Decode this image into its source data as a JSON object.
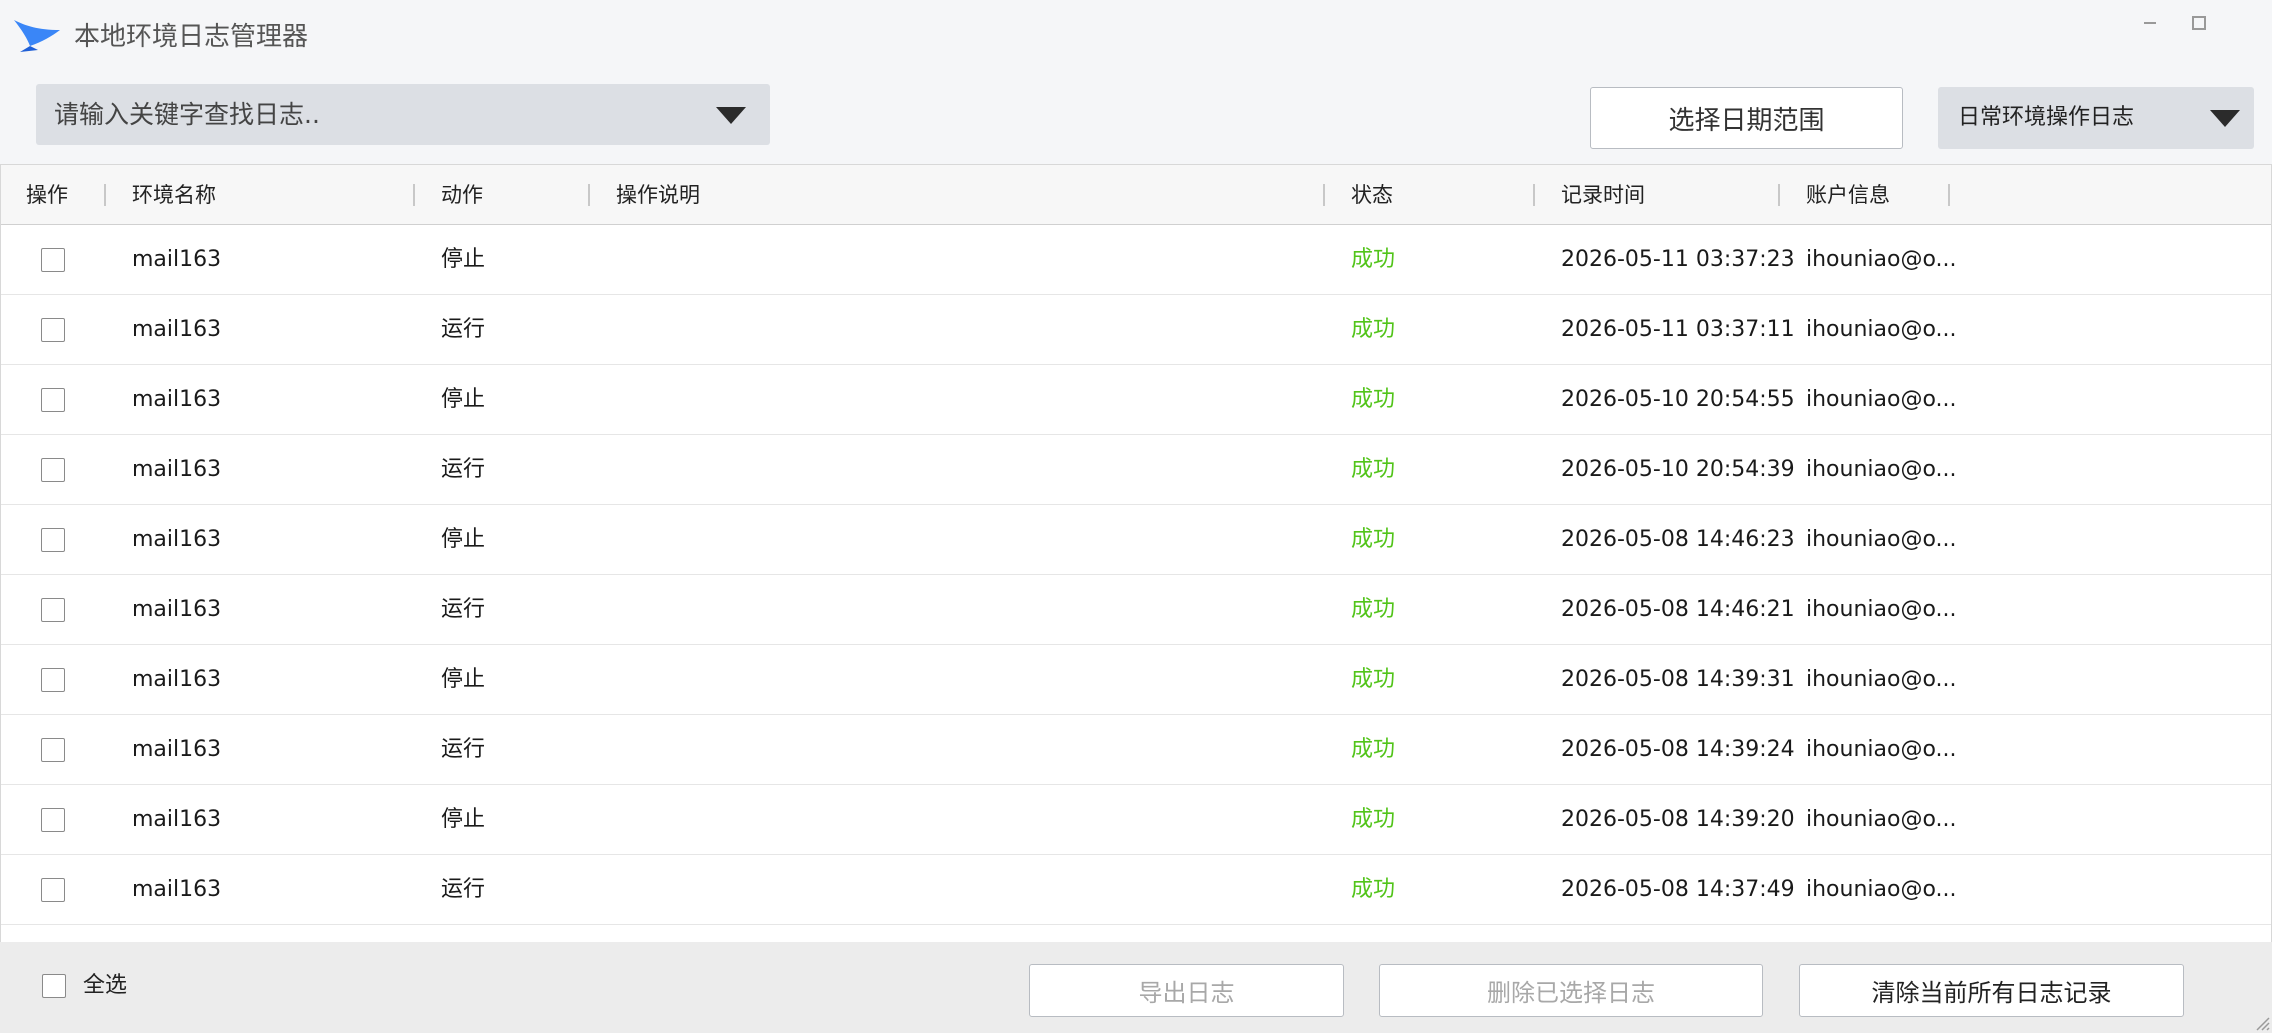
{
  "window": {
    "title": "本地环境日志管理器",
    "controls": [
      "minimize-icon",
      "maximize-icon"
    ]
  },
  "toolbar": {
    "search_placeholder": "请输入关键字查找日志..",
    "date_range_label": "选择日期范围",
    "log_type_selected": "日常环境操作日志"
  },
  "table": {
    "headers": {
      "op": "操作",
      "env": "环境名称",
      "action": "动作",
      "desc": "操作说明",
      "status": "状态",
      "time": "记录时间",
      "account": "账户信息"
    },
    "rows": [
      {
        "env": "mail163",
        "action": "停止",
        "desc": "",
        "status": "成功",
        "time": "2026-05-11 03:37:23",
        "account": "ihouniao@o..."
      },
      {
        "env": "mail163",
        "action": "运行",
        "desc": "",
        "status": "成功",
        "time": "2026-05-11 03:37:11",
        "account": "ihouniao@o..."
      },
      {
        "env": "mail163",
        "action": "停止",
        "desc": "",
        "status": "成功",
        "time": "2026-05-10 20:54:55",
        "account": "ihouniao@o..."
      },
      {
        "env": "mail163",
        "action": "运行",
        "desc": "",
        "status": "成功",
        "time": "2026-05-10 20:54:39",
        "account": "ihouniao@o..."
      },
      {
        "env": "mail163",
        "action": "停止",
        "desc": "",
        "status": "成功",
        "time": "2026-05-08 14:46:23",
        "account": "ihouniao@o..."
      },
      {
        "env": "mail163",
        "action": "运行",
        "desc": "",
        "status": "成功",
        "time": "2026-05-08 14:46:21",
        "account": "ihouniao@o..."
      },
      {
        "env": "mail163",
        "action": "停止",
        "desc": "",
        "status": "成功",
        "time": "2026-05-08 14:39:31",
        "account": "ihouniao@o..."
      },
      {
        "env": "mail163",
        "action": "运行",
        "desc": "",
        "status": "成功",
        "time": "2026-05-08 14:39:24",
        "account": "ihouniao@o..."
      },
      {
        "env": "mail163",
        "action": "停止",
        "desc": "",
        "status": "成功",
        "time": "2026-05-08 14:39:20",
        "account": "ihouniao@o..."
      },
      {
        "env": "mail163",
        "action": "运行",
        "desc": "",
        "status": "成功",
        "time": "2026-05-08 14:37:49",
        "account": "ihouniao@o..."
      }
    ]
  },
  "footer": {
    "select_all_label": "全选",
    "export_label": "导出日志",
    "delete_selected_label": "删除已选择日志",
    "clear_all_label": "清除当前所有日志记录"
  },
  "colors": {
    "status_success": "#52c41a",
    "logo_blue": "#2f7bf5"
  }
}
